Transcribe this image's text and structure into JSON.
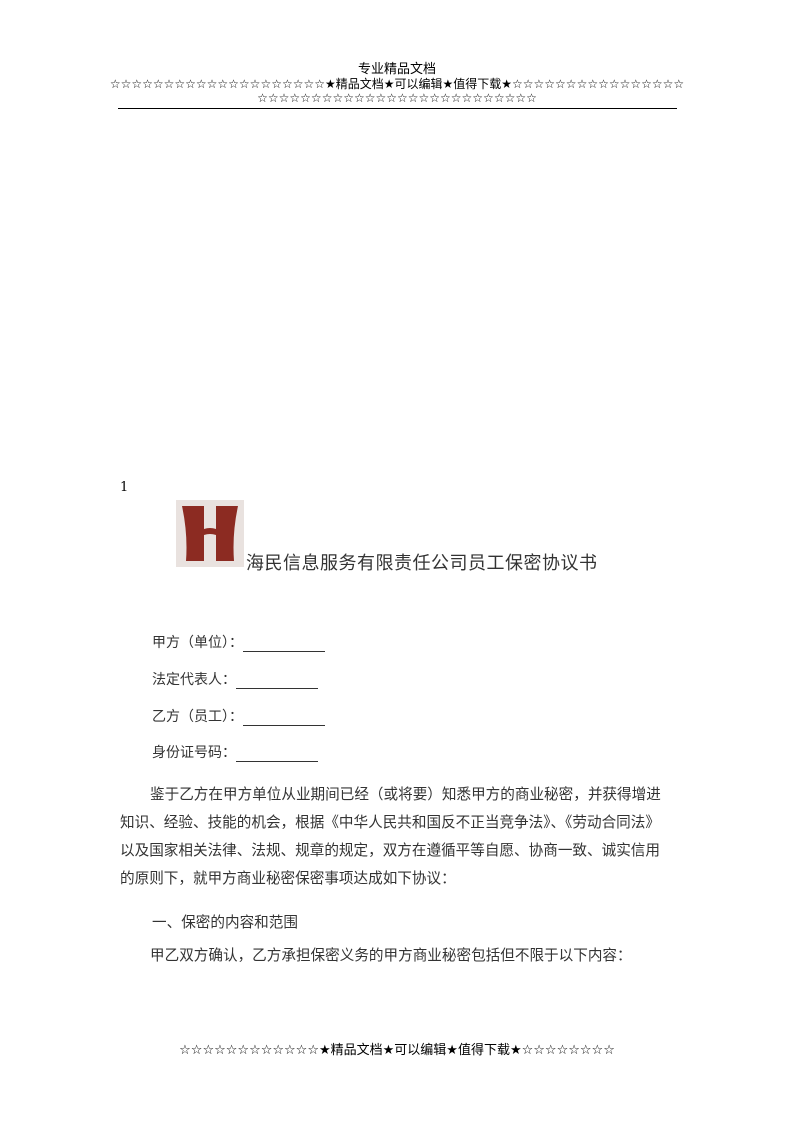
{
  "header": {
    "title": "专业精品文档",
    "stars_line1": "☆☆☆☆☆☆☆☆☆☆☆☆☆☆☆☆☆☆☆☆★精品文档★可以编辑★值得下载★☆☆☆☆☆☆☆☆☆☆☆☆☆☆☆☆",
    "stars_line2": "☆☆☆☆☆☆☆☆☆☆☆☆☆☆☆☆☆☆☆☆☆☆☆☆☆☆"
  },
  "page_number": "1",
  "logo": {
    "icon": "company-logo-h",
    "colors": {
      "background": "#e9e2df",
      "shape": "#8c2b22"
    }
  },
  "document": {
    "title": "海民信息服务有限责任公司员工保密协议书",
    "fields": [
      {
        "label": "甲方（单位）："
      },
      {
        "label": "法定代表人："
      },
      {
        "label": "乙方（员工）："
      },
      {
        "label": "身份证号码："
      }
    ],
    "intro_paragraph": "鉴于乙方在甲方单位从业期间已经（或将要）知悉甲方的商业秘密，并获得增进知识、经验、技能的机会，根据《中华人民共和国反不正当竞争法》、《劳动合同法》以及国家相关法律、法规、规章的规定，双方在遵循平等自愿、协商一致、诚实信用的原则下，就甲方商业秘密保密事项达成如下协议：",
    "section1_heading": "一、保密的内容和范围",
    "section1_paragraph": "甲乙双方确认，乙方承担保密义务的甲方商业秘密包括但不限于以下内容："
  },
  "footer": {
    "stars": "☆☆☆☆☆☆☆☆☆☆☆☆★精品文档★可以编辑★值得下载★☆☆☆☆☆☆☆☆"
  }
}
